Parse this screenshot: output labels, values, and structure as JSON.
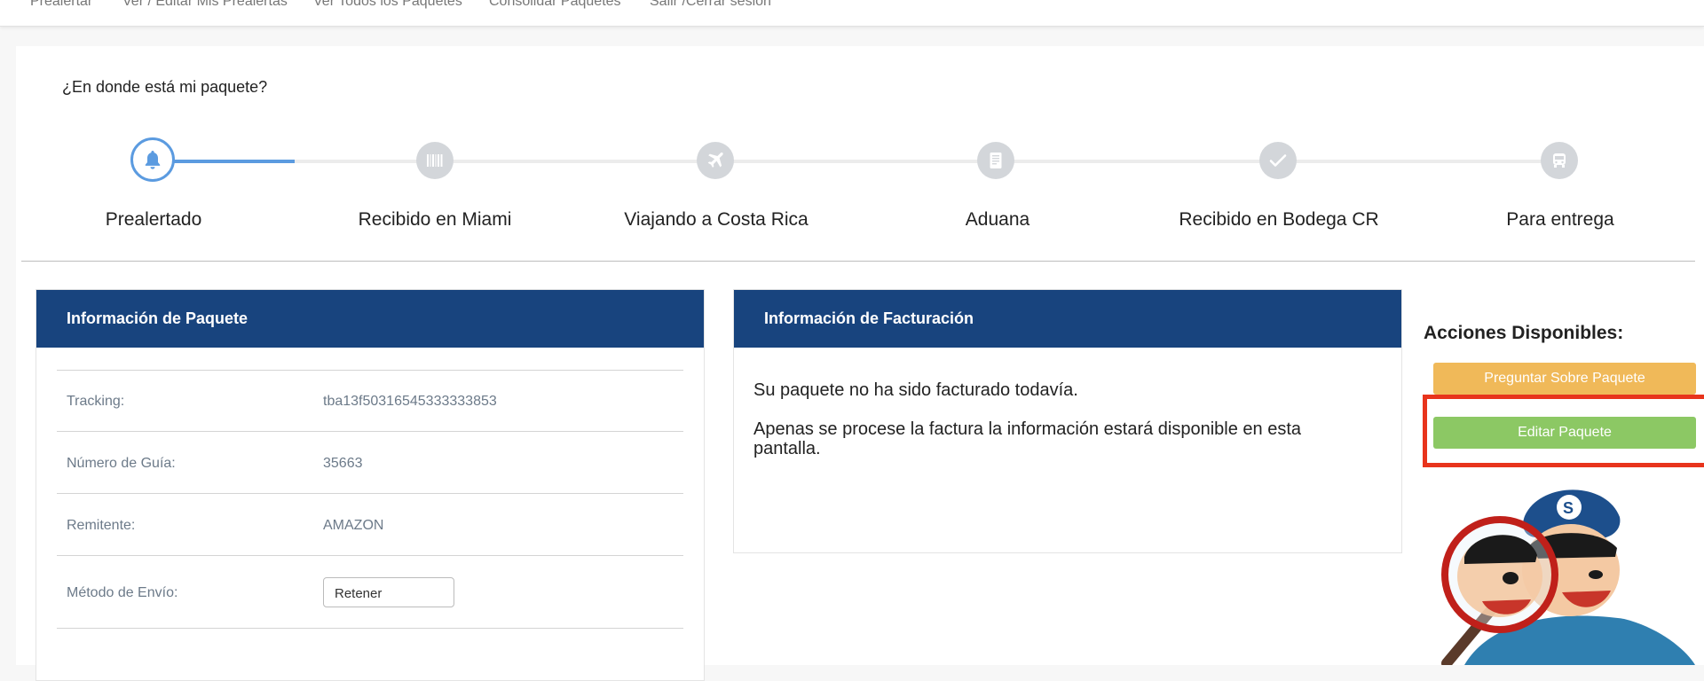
{
  "nav": {
    "items": [
      "Prealertar",
      "Ver / Editar Mis Prealertas",
      "Ver Todos los Paquetes",
      "Consolidar Paquetes",
      "Salir /Cerrar sesion"
    ]
  },
  "tracker": {
    "title": "¿En donde está mi paquete?",
    "steps": [
      {
        "label": "Prealertado",
        "icon": "bell-icon",
        "active": true
      },
      {
        "label": "Recibido en Miami",
        "icon": "barcode-icon",
        "active": false
      },
      {
        "label": "Viajando a Costa Rica",
        "icon": "airplane-icon",
        "active": false
      },
      {
        "label": "Aduana",
        "icon": "document-icon",
        "active": false
      },
      {
        "label": "Recibido en Bodega CR",
        "icon": "checkmark-icon",
        "active": false
      },
      {
        "label": "Para entrega",
        "icon": "bus-icon",
        "active": false
      }
    ]
  },
  "package_info": {
    "title": "Información de Paquete",
    "rows": [
      {
        "label": "Tracking:",
        "value": "tba13f50316545333333853"
      },
      {
        "label": "Número de Guía:",
        "value": "35663"
      },
      {
        "label": "Remitente:",
        "value": "AMAZON"
      },
      {
        "label": "Método de Envío:",
        "value": "Retener"
      }
    ]
  },
  "billing_info": {
    "title": "Información de Facturación",
    "message1": "Su paquete no ha sido facturado todavía.",
    "message2": "Apenas se procese la factura la información estará disponible en esta pantalla."
  },
  "actions": {
    "title": "Acciones Disponibles:",
    "ask_label": "Preguntar Sobre Paquete",
    "edit_label": "Editar Paquete"
  },
  "colors": {
    "header_blue": "#18447e",
    "progress_blue": "#5b9be0",
    "ask_orange": "#f0b959",
    "edit_green": "#8cc864",
    "highlight_red": "#e8341c"
  }
}
